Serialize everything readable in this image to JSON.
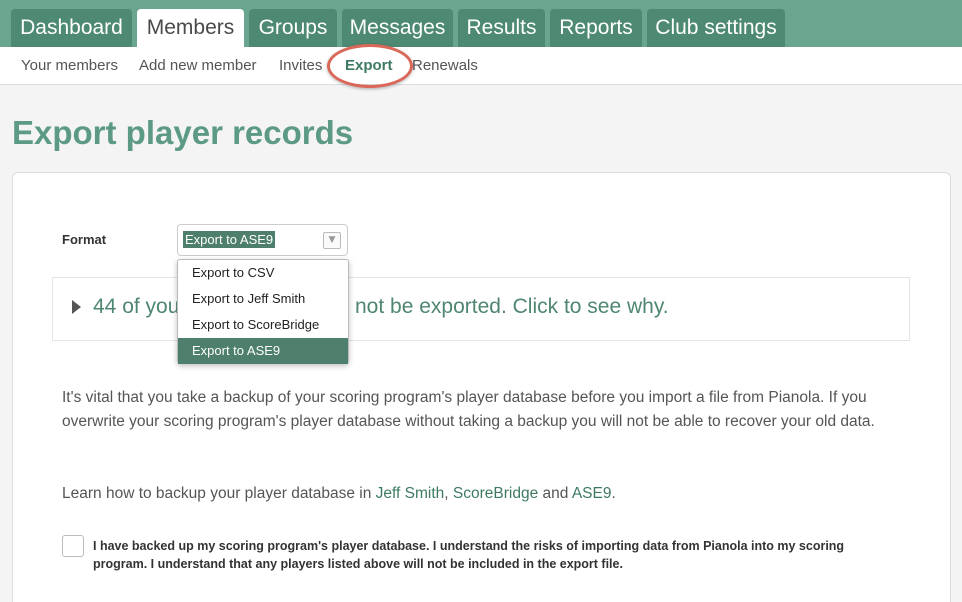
{
  "nav": {
    "tabs": [
      {
        "label": "Dashboard",
        "active": false
      },
      {
        "label": "Members",
        "active": true
      },
      {
        "label": "Groups",
        "active": false
      },
      {
        "label": "Messages",
        "active": false
      },
      {
        "label": "Results",
        "active": false
      },
      {
        "label": "Reports",
        "active": false
      },
      {
        "label": "Club settings",
        "active": false
      }
    ],
    "subnav": [
      {
        "label": "Your members",
        "active": false
      },
      {
        "label": "Add new member",
        "active": false
      },
      {
        "label": "Invites",
        "active": false
      },
      {
        "label": "Export",
        "active": true
      },
      {
        "label": "Renewals",
        "active": false
      }
    ]
  },
  "page": {
    "title": "Export player records"
  },
  "form": {
    "format_label": "Format",
    "format_selected": "Export to ASE9",
    "format_options": [
      "Export to CSV",
      "Export to Jeff Smith",
      "Export to ScoreBridge",
      "Export to ASE9"
    ],
    "notice_prefix": "44 of you",
    "notice_suffix": "not be exported. Click to see why.",
    "warning": "It's vital that you take a backup of your scoring program's player database before you import a file from Pianola. If you overwrite your scoring program's player database without taking a backup you will not be able to recover your old data.",
    "learn_prefix": "Learn how to backup your player database in ",
    "learn_links": [
      "Jeff Smith",
      "ScoreBridge",
      "ASE9"
    ],
    "learn_sep1": ", ",
    "learn_sep2": " and ",
    "learn_end": ".",
    "confirm_text": "I have backed up my scoring program's player database. I understand the risks of importing data from Pianola into my scoring program. I understand that any players listed above will not be included in the export file.",
    "confirm_checked": false
  },
  "colors": {
    "brand": "#6aa68f",
    "tab": "#4e8a73",
    "accent": "#4e7f6c",
    "title": "#5c9a85",
    "highlight": "#d9685a"
  }
}
